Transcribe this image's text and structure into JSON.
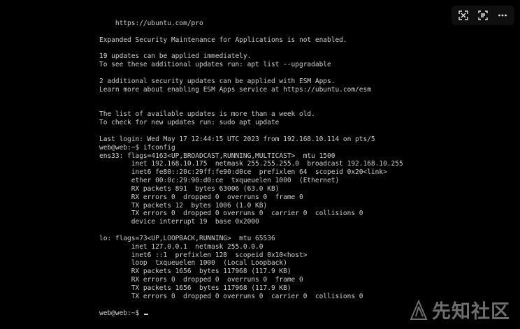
{
  "terminal": {
    "lines": [
      "    https://ubuntu.com/pro",
      "",
      "Expanded Security Maintenance for Applications is not enabled.",
      "",
      "19 updates can be applied immediately.",
      "To see these additional updates run: apt list --upgradable",
      "",
      "2 additional security updates can be applied with ESM Apps.",
      "Learn more about enabling ESM Apps service at https://ubuntu.com/esm",
      "",
      "",
      "The list of available updates is more than a week old.",
      "To check for new updates run: sudo apt update",
      "",
      "Last login: Wed May 17 12:44:15 UTC 2023 from 192.168.10.114 on pts/5",
      "web@web:~$ ifconfig",
      "ens33: flags=4163<UP,BROADCAST,RUNNING,MULTICAST>  mtu 1500",
      "        inet 192.168.10.175  netmask 255.255.255.0  broadcast 192.168.10.255",
      "        inet6 fe80::20c:29ff:fe90:d0ce  prefixlen 64  scopeid 0x20<link>",
      "        ether 00:0c:29:90:d0:ce  txqueuelen 1000  (Ethernet)",
      "        RX packets 891  bytes 63006 (63.0 KB)",
      "        RX errors 0  dropped 0  overruns 0  frame 0",
      "        TX packets 12  bytes 1006 (1.0 KB)",
      "        TX errors 0  dropped 0 overruns 0  carrier 0  collisions 0",
      "        device interrupt 19  base 0x2000",
      "",
      "lo: flags=73<UP,LOOPBACK,RUNNING>  mtu 65536",
      "        inet 127.0.0.1  netmask 255.0.0.0",
      "        inet6 ::1  prefixlen 128  scopeid 0x10<host>",
      "        loop  txqueuelen 1000  (Local Loopback)",
      "        RX packets 1656  bytes 117968 (117.9 KB)",
      "        RX errors 0  dropped 0  overruns 0  frame 0",
      "        TX packets 1656  bytes 117968 (117.9 KB)",
      "        TX errors 0  dropped 0 overruns 0  carrier 0  collisions 0",
      "",
      "web@web:~$ "
    ]
  },
  "toolbar": {
    "icons": [
      "expand-icon",
      "scan-text-icon",
      "more-icon"
    ]
  },
  "watermark": {
    "text": "先知社区"
  },
  "colors": {
    "background": "#000000",
    "text": "#d2d2d2"
  }
}
